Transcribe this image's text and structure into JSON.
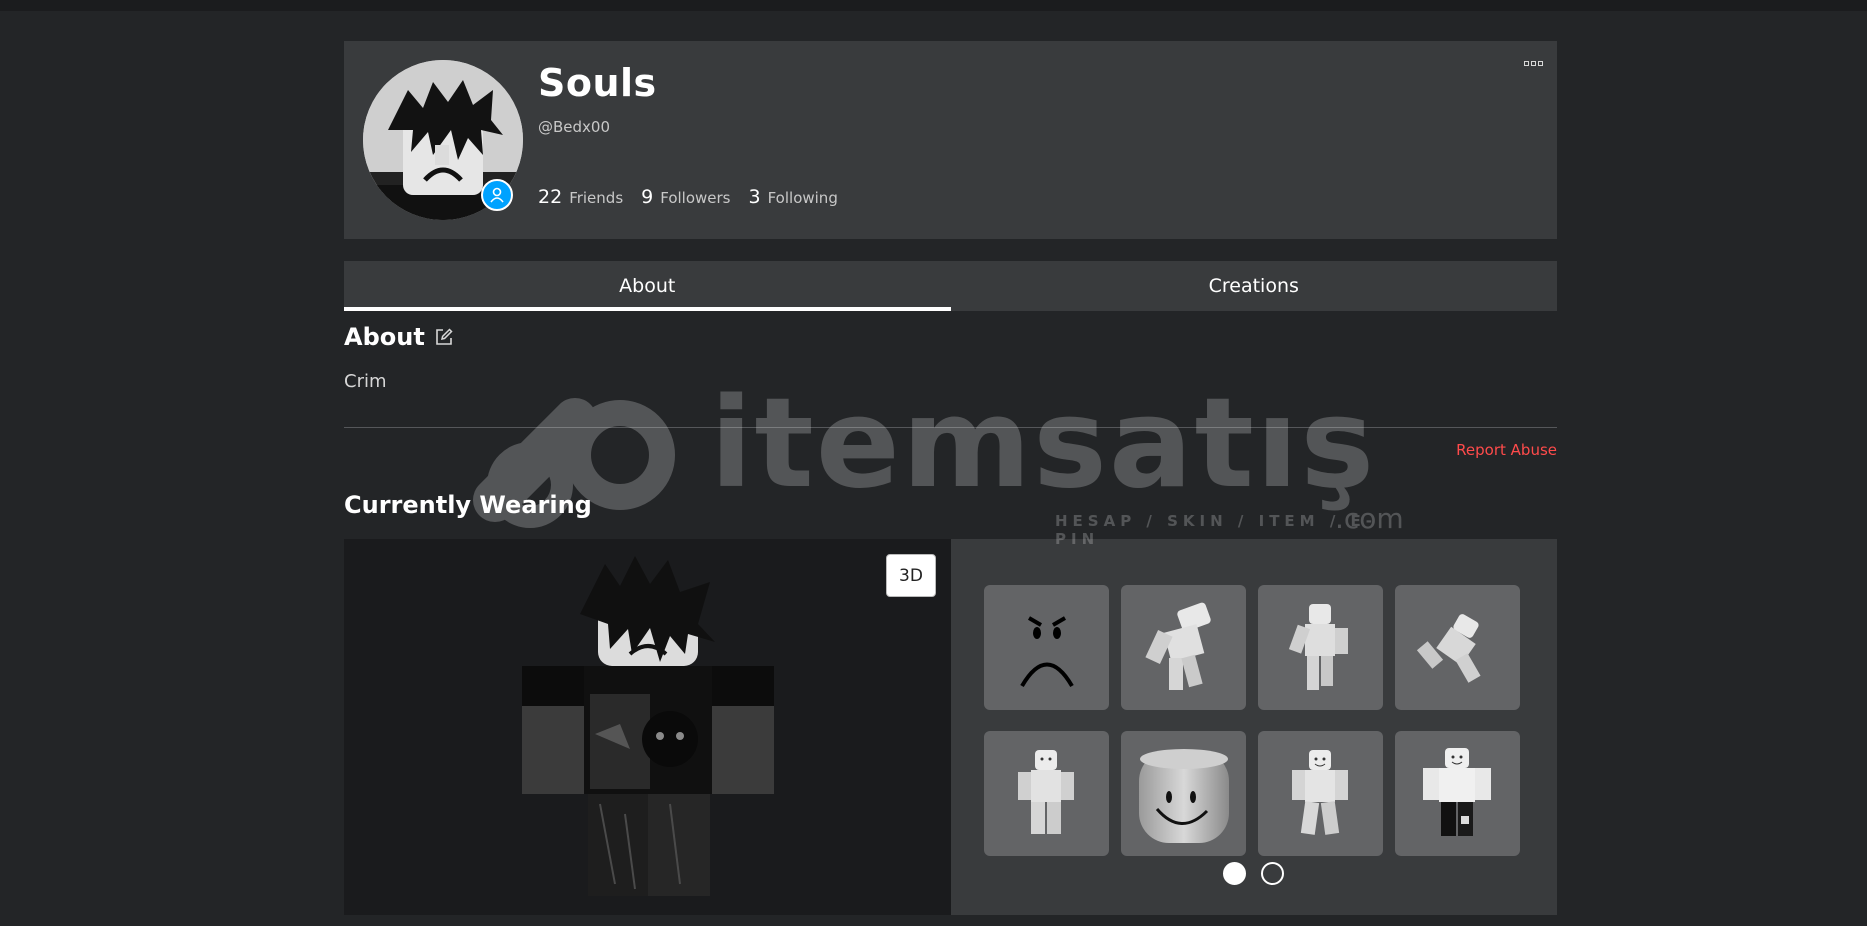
{
  "profile": {
    "display_name": "Souls",
    "username": "@Bedx00",
    "stats": [
      {
        "count": "22",
        "label": "Friends"
      },
      {
        "count": "9",
        "label": "Followers"
      },
      {
        "count": "3",
        "label": "Following"
      }
    ]
  },
  "tabs": [
    {
      "label": "About",
      "active": true
    },
    {
      "label": "Creations",
      "active": false
    }
  ],
  "about": {
    "heading": "About",
    "description": "Crim",
    "report_label": "Report Abuse"
  },
  "wearing": {
    "heading": "Currently Wearing",
    "view_toggle_label": "3D",
    "items": [
      {
        "icon": "angry-face-icon"
      },
      {
        "icon": "animation-pose-icon"
      },
      {
        "icon": "animation-pose-icon"
      },
      {
        "icon": "animation-pose-icon"
      },
      {
        "icon": "animation-pose-icon"
      },
      {
        "icon": "classic-head-icon"
      },
      {
        "icon": "animation-pose-icon"
      },
      {
        "icon": "avatar-outfit-icon"
      }
    ],
    "pagination": {
      "pages": 2,
      "current": 1
    }
  },
  "watermark": {
    "word": "itemsatış",
    "tagline": "HESAP / SKIN / ITEM / E-PIN",
    "domain": ".com"
  },
  "colors": {
    "background": "#232527",
    "card": "#393b3d",
    "accent_presence": "#00a2ff",
    "report": "#ff4b4b"
  }
}
